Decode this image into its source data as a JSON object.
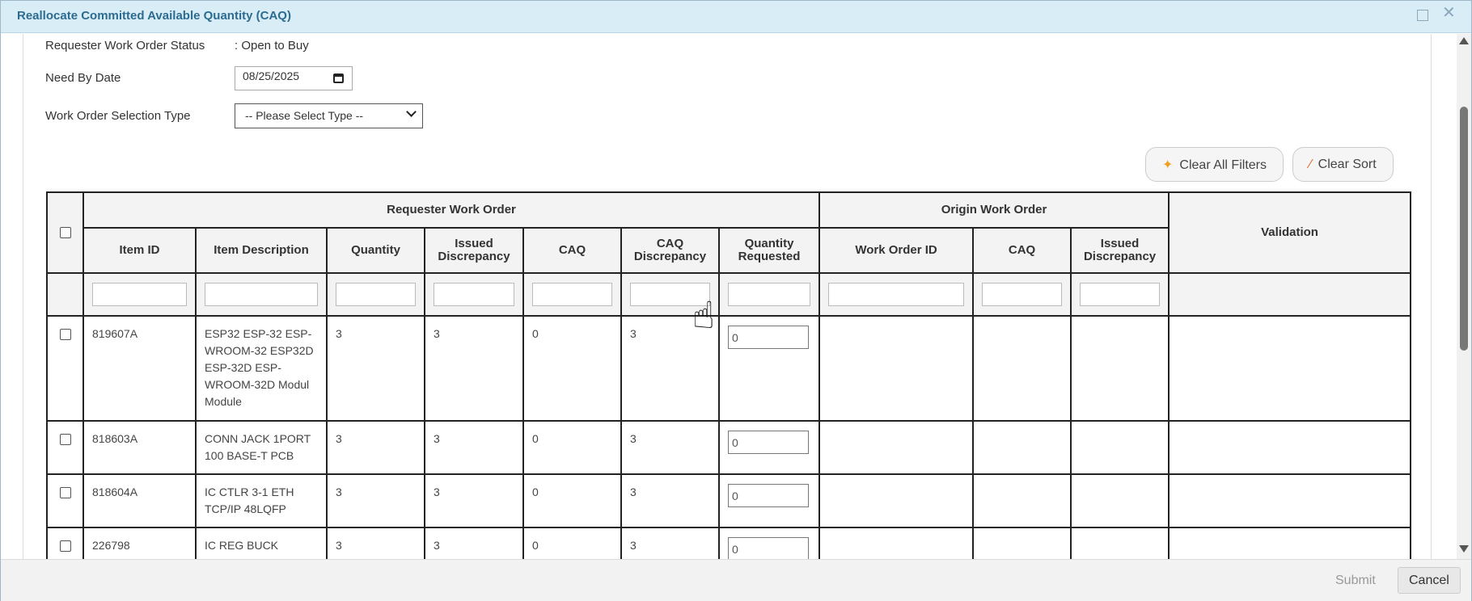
{
  "dialog": {
    "title": "Reallocate Committed Available Quantity (CAQ)"
  },
  "form": {
    "status_label": "Requester Work Order Status",
    "status_value": ": Open to Buy",
    "need_by_label": "Need By Date",
    "need_by_value": "08/25/2025",
    "selection_type_label": "Work Order Selection Type",
    "selection_type_value": "-- Please Select Type --"
  },
  "toolbar": {
    "clear_filters": "Clear All Filters",
    "clear_sort": "Clear Sort"
  },
  "table": {
    "group_requester": "Requester Work Order",
    "group_origin": "Origin Work Order",
    "validation": "Validation",
    "columns": [
      "Item ID",
      "Item Description",
      "Quantity",
      "Issued Discrepancy",
      "CAQ",
      "CAQ Discrepancy",
      "Quantity Requested",
      "Work Order ID",
      "CAQ",
      "Issued Discrepancy"
    ],
    "rows": [
      {
        "item_id": "819607A",
        "description": "ESP32 ESP-32 ESP-WROOM-32 ESP32D ESP-32D ESP-WROOM-32D Modul Module",
        "quantity": "3",
        "issued_discrepancy": "3",
        "caq": "0",
        "caq_discrepancy": "3",
        "qty_requested": "0"
      },
      {
        "item_id": "818603A",
        "description": "CONN JACK 1PORT 100 BASE-T PCB",
        "quantity": "3",
        "issued_discrepancy": "3",
        "caq": "0",
        "caq_discrepancy": "3",
        "qty_requested": "0"
      },
      {
        "item_id": "818604A",
        "description": "IC CTLR 3-1 ETH TCP/IP 48LQFP",
        "quantity": "3",
        "issued_discrepancy": "3",
        "caq": "0",
        "caq_discrepancy": "3",
        "qty_requested": "0"
      },
      {
        "item_id": "226798",
        "description": "IC REG BUCK",
        "quantity": "3",
        "issued_discrepancy": "3",
        "caq": "0",
        "caq_discrepancy": "3",
        "qty_requested": "0"
      }
    ]
  },
  "footer": {
    "submit": "Submit",
    "cancel": "Cancel"
  }
}
